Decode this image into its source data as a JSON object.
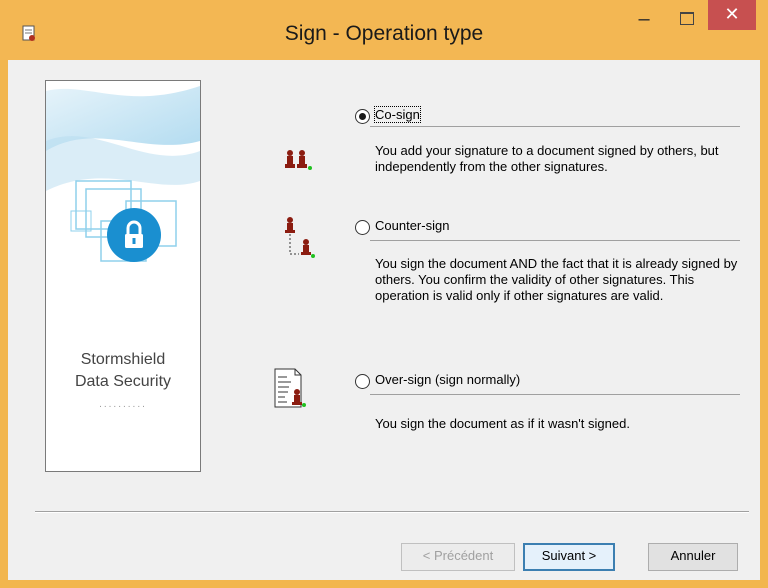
{
  "window": {
    "title": "Sign - Operation type",
    "icons": {
      "app": "signature-document-icon",
      "minimize": "minimize-icon",
      "maximize": "maximize-icon",
      "close": "close-icon"
    }
  },
  "brand": {
    "line1": "Stormshield",
    "line2": "Data Security",
    "dots": "..........",
    "accent": "#1a8fd0"
  },
  "options": [
    {
      "label": "Co-sign",
      "checked": true,
      "icon": "co-sign-icon",
      "description": "You add your signature to a document signed by others, but independently from the other signatures."
    },
    {
      "label": "Counter-sign",
      "checked": false,
      "icon": "counter-sign-icon",
      "description": "You sign the document AND the fact that it is already signed by others. You confirm the validity of other signatures. This operation is valid only if other signatures are valid."
    },
    {
      "label": "Over-sign (sign normally)",
      "checked": false,
      "icon": "over-sign-icon",
      "description": "You sign the document as if it wasn't signed."
    }
  ],
  "buttons": {
    "previous": "< Précédent",
    "next": "Suivant >",
    "cancel": "Annuler"
  },
  "colors": {
    "titlebar": "#f3b753",
    "close": "#c75050",
    "client": "#f0f0f0"
  }
}
